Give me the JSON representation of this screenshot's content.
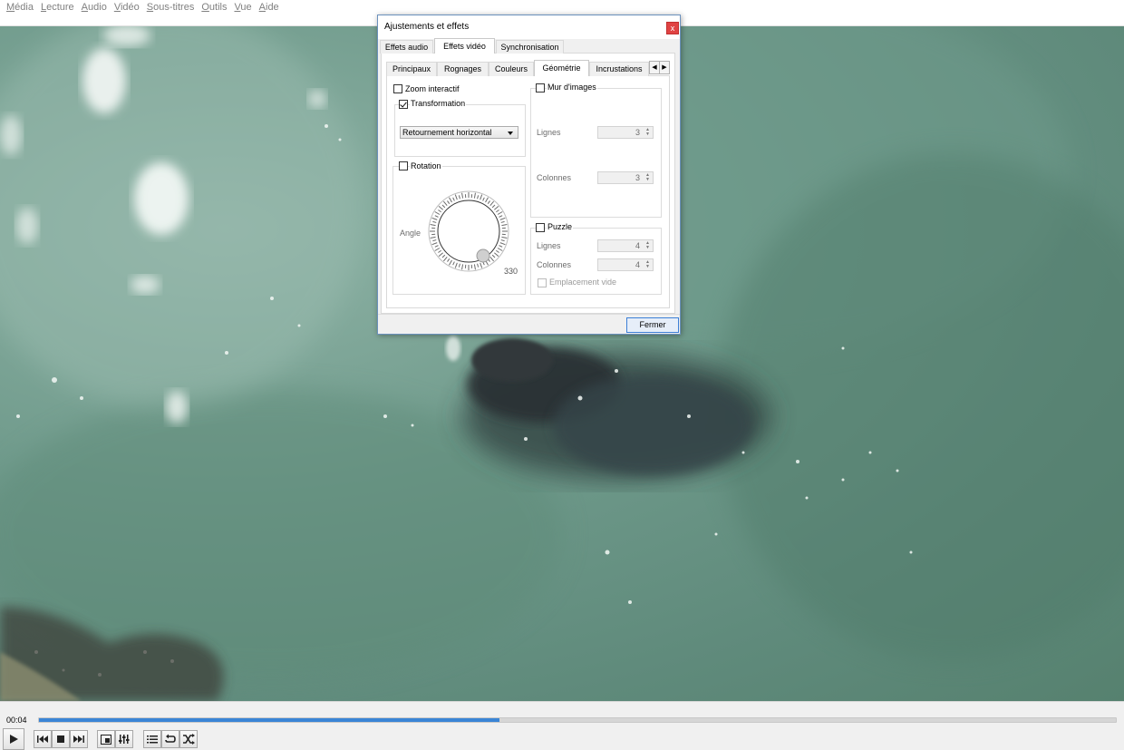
{
  "menu": [
    {
      "accel": "M",
      "rest": "édia"
    },
    {
      "accel": "L",
      "rest": "ecture"
    },
    {
      "accel": "A",
      "rest": "udio"
    },
    {
      "accel": "V",
      "rest": "idéo"
    },
    {
      "accel": "S",
      "rest": "ous-titres"
    },
    {
      "accel": "O",
      "rest": "utils"
    },
    {
      "accel": "V",
      "rest": "ue"
    },
    {
      "accel": "A",
      "rest": "ide"
    }
  ],
  "player": {
    "time_elapsed": "00:04",
    "progress_fraction": 0.428,
    "accent_color": "#3a85d6"
  },
  "dialog": {
    "title": "Ajustements et effets",
    "close_label": "x",
    "tabs": [
      "Effets audio",
      "Effets vidéo",
      "Synchronisation"
    ],
    "active_tab": "Effets vidéo",
    "subtabs": [
      "Principaux",
      "Rognages",
      "Couleurs",
      "Géométrie",
      "Incrustations"
    ],
    "active_subtab": "Géométrie",
    "zoom_interactif": {
      "label": "Zoom interactif",
      "checked": false
    },
    "transformation": {
      "label": "Transformation",
      "checked": true,
      "selected": "Retournement horizontal"
    },
    "rotation": {
      "label": "Rotation",
      "checked": false,
      "angle_label": "Angle",
      "angle_value": "330"
    },
    "mur_images": {
      "label": "Mur d'images",
      "checked": false,
      "lignes_label": "Lignes",
      "lignes_value": "3",
      "colonnes_label": "Colonnes",
      "colonnes_value": "3"
    },
    "puzzle": {
      "label": "Puzzle",
      "checked": false,
      "lignes_label": "Lignes",
      "lignes_value": "4",
      "colonnes_label": "Colonnes",
      "colonnes_value": "4",
      "emplacement_label": "Emplacement vide",
      "emplacement_checked": false
    },
    "close_button": "Fermer"
  }
}
